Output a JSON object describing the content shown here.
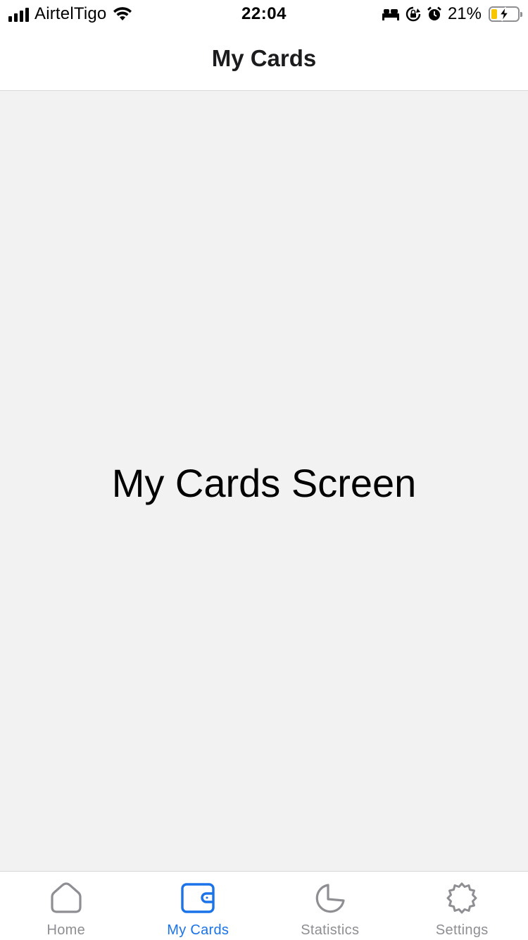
{
  "status_bar": {
    "carrier": "AirtelTigo",
    "time": "22:04",
    "battery_percent": "21%",
    "battery_level": 0.21,
    "icons": [
      "signal-icon",
      "wifi-icon",
      "sleep-icon",
      "orientation-lock-icon",
      "alarm-icon",
      "battery-icon",
      "charging-bolt-icon"
    ]
  },
  "header": {
    "title": "My Cards"
  },
  "main": {
    "label": "My Cards Screen"
  },
  "tab_bar": {
    "tabs": [
      {
        "label": "Home",
        "icon": "home-icon",
        "active": false
      },
      {
        "label": "My Cards",
        "icon": "wallet-icon",
        "active": true
      },
      {
        "label": "Statistics",
        "icon": "pie-chart-icon",
        "active": false
      },
      {
        "label": "Settings",
        "icon": "gear-icon",
        "active": false
      }
    ]
  },
  "colors": {
    "accent": "#1a73e8",
    "inactive": "#8e8e93",
    "battery_low": "#f7c600",
    "background": "#f2f2f2"
  }
}
